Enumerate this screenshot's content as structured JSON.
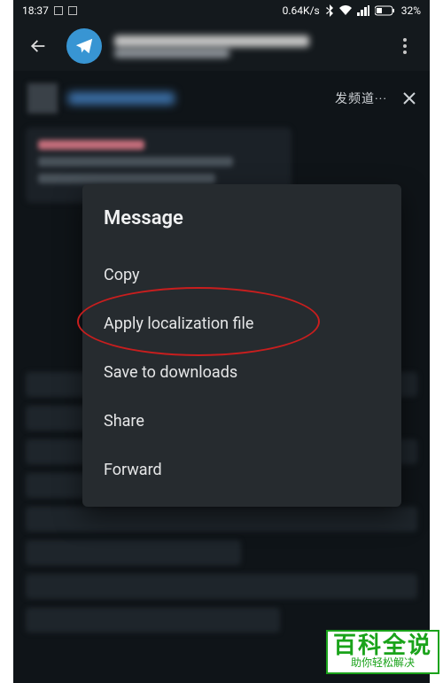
{
  "statusbar": {
    "time": "18:37",
    "netspeed": "0.64K/s",
    "battery": "32%"
  },
  "appbar": {
    "back_label": "Back"
  },
  "pinned": {
    "channel_label": "发频道···"
  },
  "dialog": {
    "title": "Message",
    "items": [
      "Copy",
      "Apply localization file",
      "Save to downloads",
      "Share",
      "Forward"
    ]
  },
  "watermark": {
    "main": "百科全说",
    "sub": "助你轻松解决"
  }
}
